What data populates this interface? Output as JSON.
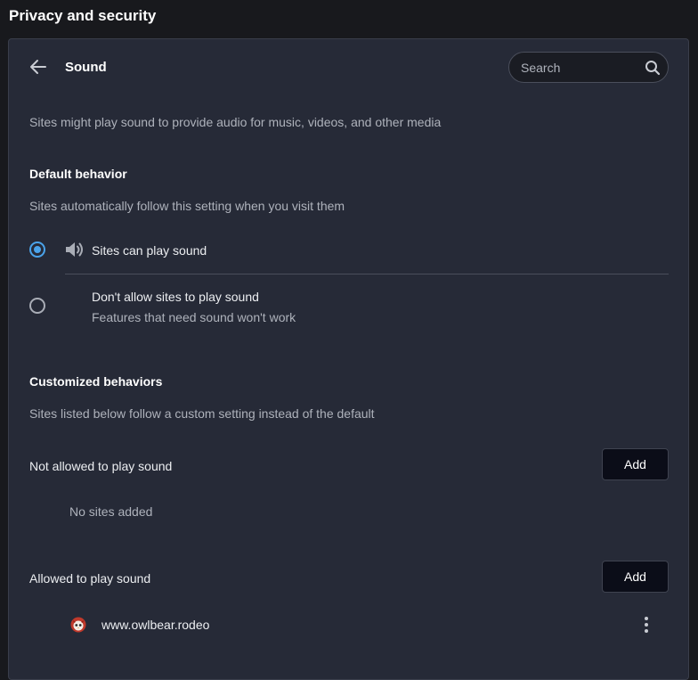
{
  "section_title": "Privacy and security",
  "header": {
    "title": "Sound",
    "search_placeholder": "Search"
  },
  "description": "Sites might play sound to provide audio for music, videos, and other media",
  "default_behavior": {
    "heading": "Default behavior",
    "subtitle": "Sites automatically follow this setting when you visit them",
    "options": [
      {
        "label": "Sites can play sound",
        "selected": true,
        "icon": "speaker-icon"
      },
      {
        "label": "Don't allow sites to play sound",
        "sublabel": "Features that need sound won't work",
        "selected": false
      }
    ]
  },
  "customized": {
    "heading": "Customized behaviors",
    "subtitle": "Sites listed below follow a custom setting instead of the default",
    "not_allowed": {
      "label": "Not allowed to play sound",
      "add_label": "Add",
      "empty_text": "No sites added"
    },
    "allowed": {
      "label": "Allowed to play sound",
      "add_label": "Add",
      "sites": [
        "www.owlbear.rodeo"
      ]
    }
  },
  "colors": {
    "accent": "#4aa3ea",
    "card_bg": "#262a37",
    "page_bg": "#18191d",
    "button_bg": "#0b0d18",
    "favicon": "#c0392b"
  }
}
